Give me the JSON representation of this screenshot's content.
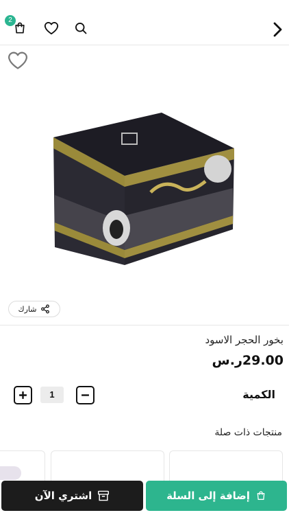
{
  "header": {
    "cart_count": "2",
    "icons": [
      "cart-icon",
      "heart-icon",
      "search-icon",
      "chevron-right-icon"
    ]
  },
  "product": {
    "name": "بخور الحجر الاسود",
    "price": "29.00ر.س",
    "image": "incense-box-product-image"
  },
  "share": {
    "label": "شارك"
  },
  "quantity": {
    "label": "الكمية",
    "value": "1"
  },
  "related": {
    "title": "منتجات ذات صلة"
  },
  "actions": {
    "add_to_cart": "إضافة إلى السلة",
    "buy_now": "اشتري الآن"
  },
  "colors": {
    "accent": "#2db58e",
    "dark": "#1c1c1c",
    "badge": "#2bb591"
  }
}
